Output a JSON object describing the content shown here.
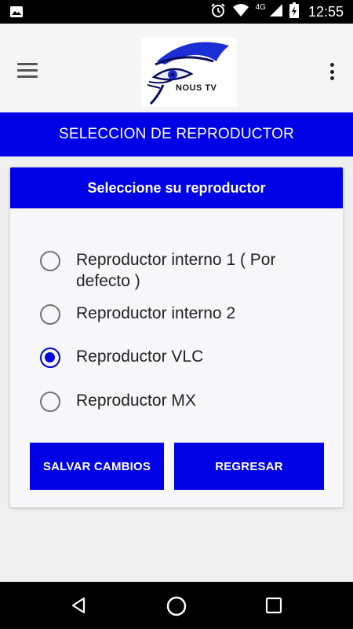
{
  "status_bar": {
    "time": "12:55",
    "network": "4G",
    "icons": [
      "image-icon",
      "alarm-icon",
      "wifi-icon",
      "signal-icon",
      "battery-icon"
    ]
  },
  "app_bar": {
    "logo_text": "NOUS TV",
    "icons": [
      "menu-icon",
      "more-vert-icon"
    ]
  },
  "title_bar": {
    "title": "SELECCION DE REPRODUCTOR"
  },
  "card": {
    "header": "Seleccione su reproductor",
    "options": [
      {
        "label": "Reproductor interno 1 ( Por defecto )",
        "selected": false
      },
      {
        "label": "Reproductor interno 2",
        "selected": false
      },
      {
        "label": "Reproductor VLC",
        "selected": true
      },
      {
        "label": "Reproductor MX",
        "selected": false
      }
    ],
    "buttons": {
      "save": "SALVAR CAMBIOS",
      "back": "REGRESAR"
    }
  },
  "colors": {
    "accent": "#0000e6",
    "background": "#efefef",
    "card": "#f7f7fa"
  },
  "nav_bar": {
    "icons": [
      "back-icon",
      "home-icon",
      "recent-apps-icon"
    ]
  }
}
